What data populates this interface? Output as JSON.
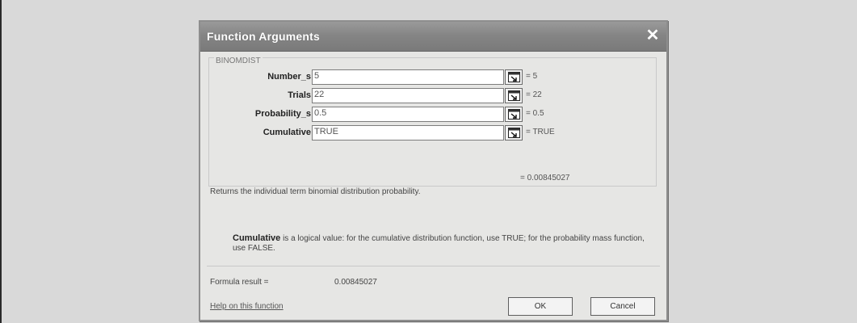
{
  "dialog": {
    "title": "Function Arguments",
    "close_glyph": "✕",
    "function_name": "BINOMDIST",
    "arguments": [
      {
        "label": "Number_s",
        "value": "5",
        "result": "= 5"
      },
      {
        "label": "Trials",
        "value": "22",
        "result": "= 22"
      },
      {
        "label": "Probability_s",
        "value": "0.5",
        "result": "= 0.5"
      },
      {
        "label": "Cumulative",
        "value": "TRUE",
        "result": "= TRUE"
      }
    ],
    "result_preview": "= 0.00845027",
    "description": "Returns the individual term binomial distribution probability.",
    "arg_help_name": "Cumulative",
    "arg_help_text": "is a logical value: for the cumulative distribution function, use TRUE; for the probability mass function, use FALSE.",
    "formula_result_label": "Formula result =",
    "formula_result_value": "0.00845027",
    "help_link": "Help on this function",
    "ok_label": "OK",
    "cancel_label": "Cancel",
    "ref_button_icon": "collapse-dialog-icon"
  }
}
